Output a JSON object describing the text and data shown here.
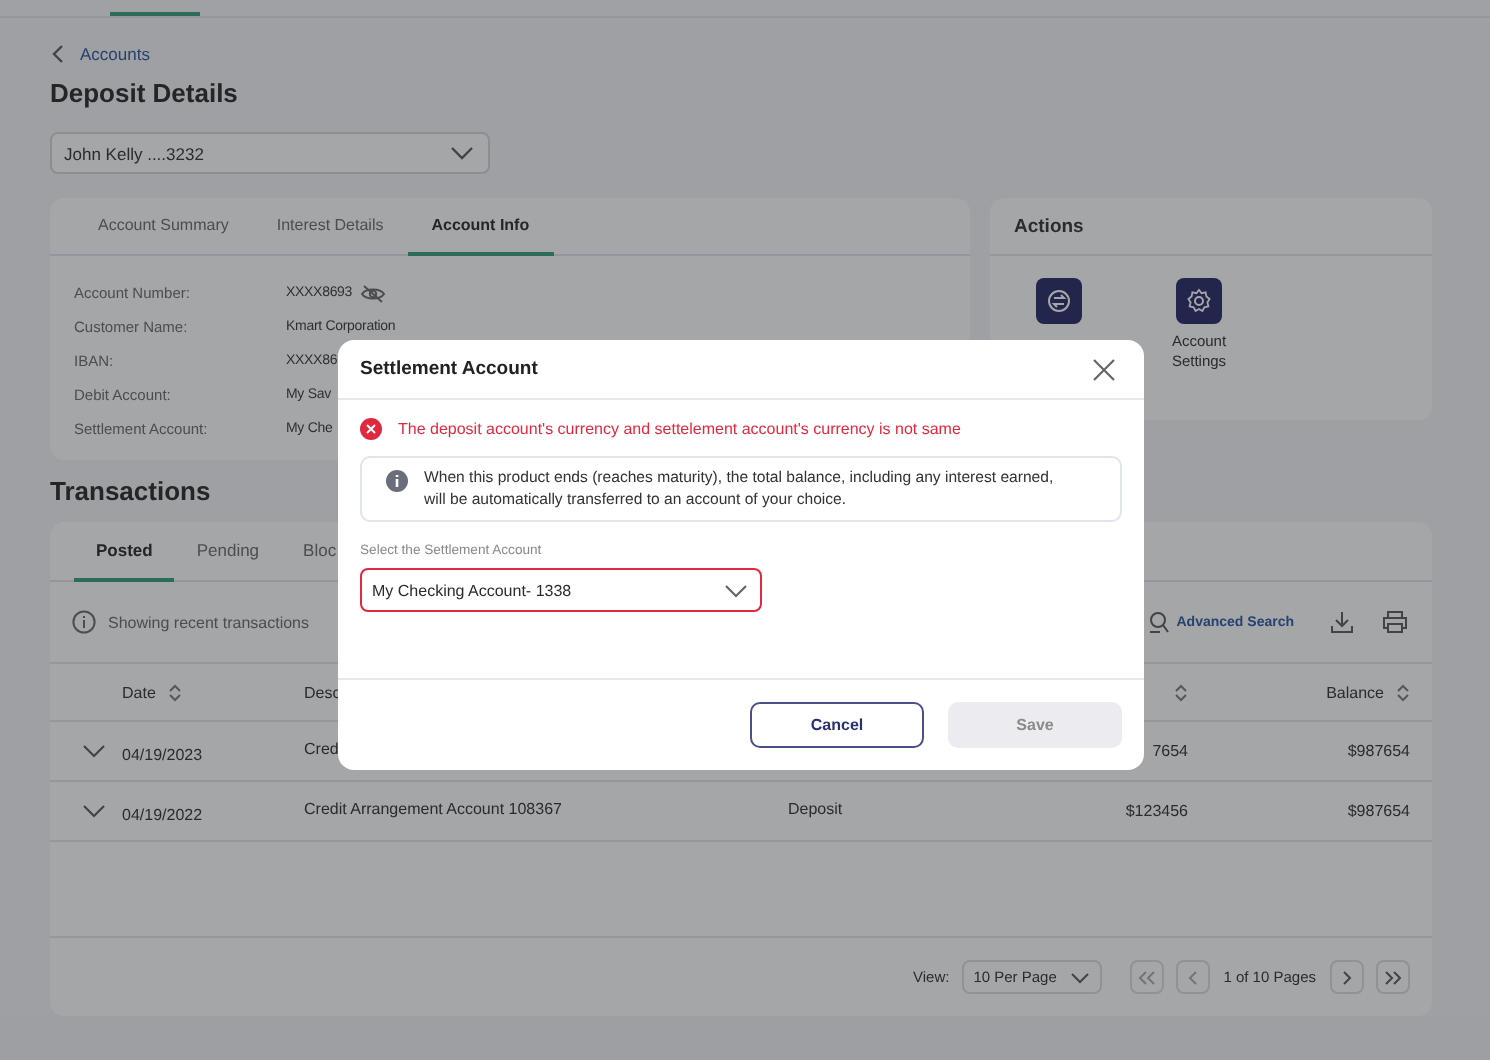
{
  "breadcrumb": {
    "label": "Accounts"
  },
  "title": "Deposit Details",
  "account_selector": {
    "value": "John Kelly ....3232"
  },
  "details_card": {
    "tabs": [
      {
        "label": "Account Summary",
        "selected": false
      },
      {
        "label": "Interest Details",
        "selected": false
      },
      {
        "label": "Account Info",
        "selected": true
      }
    ],
    "fields": [
      {
        "label": "Account Number:",
        "value": "XXXX8693",
        "masked": true
      },
      {
        "label": "Customer Name:",
        "value": "Kmart Corporation"
      },
      {
        "label": "IBAN:",
        "value": "XXXX86"
      },
      {
        "label": "Debit Account:",
        "value": "My Sav"
      },
      {
        "label": "Settlement Account:",
        "value": "My Che"
      }
    ]
  },
  "actions": {
    "title": "Actions",
    "items": [
      {
        "kind": "transfer"
      },
      {
        "kind": "settings",
        "label": "Account Settings"
      }
    ]
  },
  "transactions": {
    "title": "Transactions",
    "tabs": [
      {
        "label": "Posted",
        "selected": true
      },
      {
        "label": "Pending",
        "selected": false
      },
      {
        "label": "Bloc",
        "selected": false
      }
    ],
    "notice": "Showing recent transactions",
    "advanced_search": "Advanced Search",
    "columns": [
      {
        "kind": "date",
        "label": "Date",
        "sortable": true
      },
      {
        "kind": "description",
        "label": "Desc"
      },
      {
        "kind": "amount",
        "sortable": true
      },
      {
        "kind": "balance",
        "label": "Balance",
        "sortable": true
      }
    ],
    "rows": [
      {
        "expanded": false,
        "date": "04/19/2023",
        "description": "Cred",
        "amount": "7654",
        "balance": "$987654"
      },
      {
        "expanded": false,
        "date": "04/19/2022",
        "description": "Credit Arrangement Account 108367",
        "type": "Deposit",
        "amount": "$123456",
        "balance": "$987654"
      }
    ],
    "pagination": {
      "view_label": "View:",
      "per_page": "10 Per Page",
      "page_info": "1 of 10 Pages"
    }
  },
  "modal": {
    "title": "Settlement Account",
    "error": "The deposit account's currency and settelement account's currency is not same",
    "info": "When this product ends (reaches maturity), the total balance, including any interest earned, will be automatically transferred to an account of your choice.",
    "select_label": "Select the Settlement Account",
    "select_value": "My Checking Account- 1338",
    "invalid": true,
    "buttons": [
      {
        "label": "Cancel",
        "kind": "secondary",
        "disabled": false
      },
      {
        "label": "Save",
        "kind": "primary",
        "disabled": true
      }
    ]
  }
}
